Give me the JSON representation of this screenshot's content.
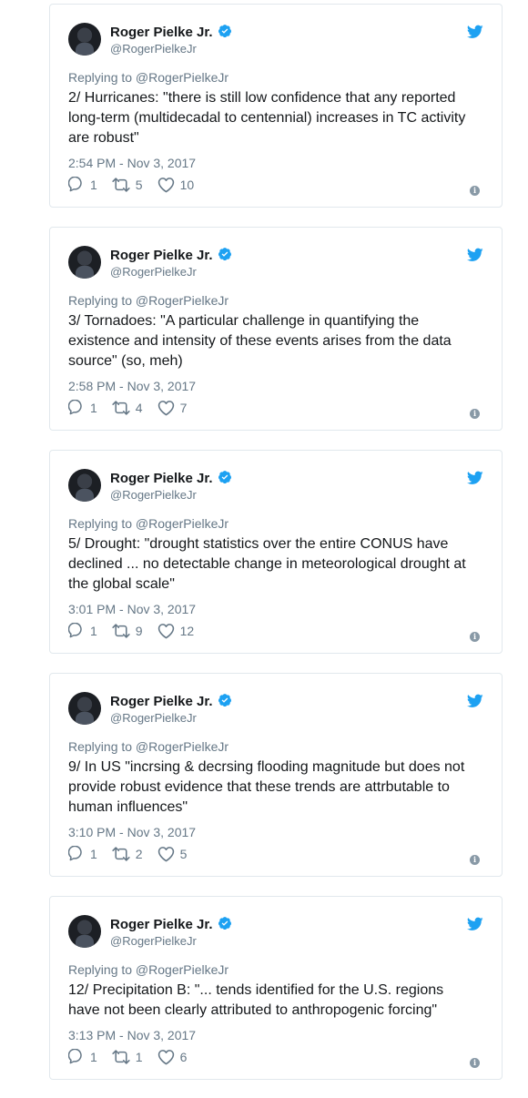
{
  "tweets": [
    {
      "name": "Roger Pielke Jr.",
      "handle": "@RogerPielkeJr",
      "reply": "Replying to @RogerPielkeJr",
      "text": "2/ Hurricanes: \"there is still low confidence that any reported long-term (multidecadal to centennial) increases in TC activity are robust\"",
      "time": "2:54 PM - Nov 3, 2017",
      "replies": "1",
      "retweets": "5",
      "likes": "10"
    },
    {
      "name": "Roger Pielke Jr.",
      "handle": "@RogerPielkeJr",
      "reply": "Replying to @RogerPielkeJr",
      "text": "3/ Tornadoes: \"A particular challenge in quantifying the existence and intensity of these events arises from the data source\" (so, meh)",
      "time": "2:58 PM - Nov 3, 2017",
      "replies": "1",
      "retweets": "4",
      "likes": "7"
    },
    {
      "name": "Roger Pielke Jr.",
      "handle": "@RogerPielkeJr",
      "reply": "Replying to @RogerPielkeJr",
      "text": "5/ Drought: \"drought statistics over the entire CONUS have declined ... no detectable change in meteorological drought at the global scale\"",
      "time": "3:01 PM - Nov 3, 2017",
      "replies": "1",
      "retweets": "9",
      "likes": "12"
    },
    {
      "name": "Roger Pielke Jr.",
      "handle": "@RogerPielkeJr",
      "reply": "Replying to @RogerPielkeJr",
      "text": "9/ In US \"incrsing & decrsing flooding magnitude but does not provide robust evidence that these trends are attrbutable to human influences\"",
      "time": "3:10 PM - Nov 3, 2017",
      "replies": "1",
      "retweets": "2",
      "likes": "5"
    },
    {
      "name": "Roger Pielke Jr.",
      "handle": "@RogerPielkeJr",
      "reply": "Replying to @RogerPielkeJr",
      "text": "12/ Precipitation B: \"... tends identified for the U.S. regions have not been clearly attributed to anthropogenic forcing\"",
      "time": "3:13 PM - Nov 3, 2017",
      "replies": "1",
      "retweets": "1",
      "likes": "6"
    }
  ],
  "colors": {
    "twitter_blue": "#1da1f2",
    "secondary_text": "#657786",
    "border": "#e1e8ed"
  },
  "icons": [
    "twitter-bird-icon",
    "verified-badge-icon",
    "reply-icon",
    "retweet-icon",
    "like-heart-icon",
    "info-icon"
  ]
}
